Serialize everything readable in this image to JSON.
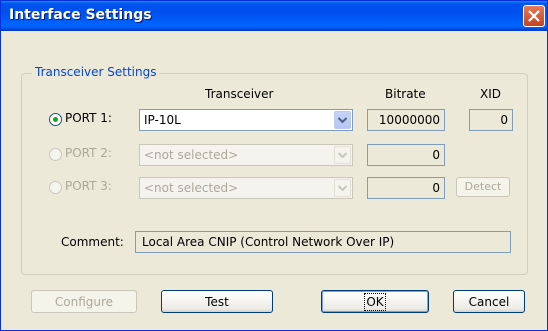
{
  "window": {
    "title": "Interface Settings"
  },
  "group": {
    "legend": "Transceiver Settings"
  },
  "columns": {
    "transceiver": "Transceiver",
    "bitrate": "Bitrate",
    "xid": "XID"
  },
  "ports": [
    {
      "label": "PORT 1:",
      "checked": true,
      "enabled": true,
      "transceiver": "IP-10L",
      "bitrate": "10000000",
      "xid": "0"
    },
    {
      "label": "PORT 2:",
      "checked": false,
      "enabled": false,
      "transceiver": "<not selected>",
      "bitrate": "0"
    },
    {
      "label": "PORT 3:",
      "checked": false,
      "enabled": false,
      "transceiver": "<not selected>",
      "bitrate": "0"
    }
  ],
  "detect_label": "Detect",
  "comment": {
    "label": "Comment:",
    "value": "Local Area CNIP (Control Network Over IP)"
  },
  "buttons": {
    "configure": "Configure",
    "test": "Test",
    "ok": "OK",
    "cancel": "Cancel"
  },
  "colors": {
    "accent": "#0046d5",
    "titlebar": "#0053ee",
    "close": "#c4431f"
  }
}
